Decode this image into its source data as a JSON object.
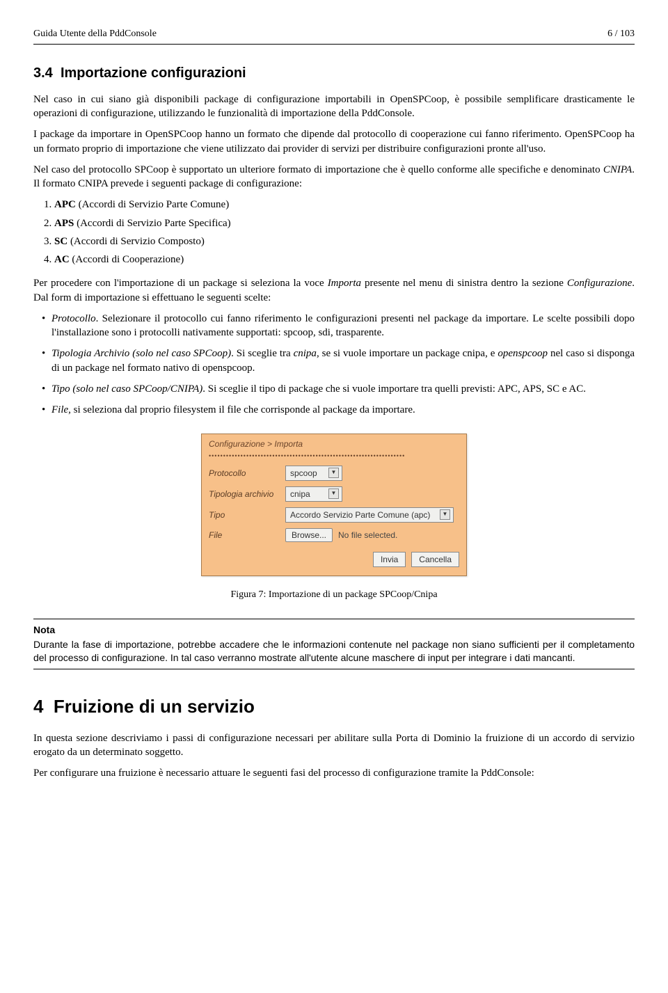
{
  "header": {
    "left": "Guida Utente della PddConsole",
    "right": "6 / 103"
  },
  "sec34": {
    "number": "3.4",
    "title": "Importazione configurazioni",
    "p1": "Nel caso in cui siano già disponibili package di configurazione importabili in OpenSPCoop, è possibile semplificare drasticamente le operazioni di configurazione, utilizzando le funzionalità di importazione della PddConsole.",
    "p2": "I package da importare in OpenSPCoop hanno un formato che dipende dal protocollo di cooperazione cui fanno riferimento. OpenSPCoop ha un formato proprio di importazione che viene utilizzato dai provider di servizi per distribuire configurazioni pronte all'uso.",
    "p3a": "Nel caso del protocollo SPCoop è supportato un ulteriore formato di importazione che è quello conforme alle specifiche e denominato ",
    "p3_em": "CNIPA",
    "p3b": ". Il formato CNIPA prevede i seguenti package di configurazione:",
    "list": [
      {
        "bold": "APC",
        "rest": " (Accordi di Servizio Parte Comune)"
      },
      {
        "bold": "APS",
        "rest": " (Accordi di Servizio Parte Specifica)"
      },
      {
        "bold": "SC",
        "rest": " (Accordi di Servizio Composto)"
      },
      {
        "bold": "AC",
        "rest": " (Accordi di Cooperazione)"
      }
    ],
    "p4a": "Per procedere con l'importazione di un package si seleziona la voce ",
    "p4_em1": "Importa",
    "p4b": " presente nel menu di sinistra dentro la sezione ",
    "p4_em2": "Configurazione",
    "p4c": ". Dal form di importazione si effettuano le seguenti scelte:",
    "bullets": {
      "b1_em": "Protocollo",
      "b1": ". Selezionare il protocollo cui fanno riferimento le configurazioni presenti nel package da importare. Le scelte possibili dopo l'installazione sono i protocolli nativamente supportati: spcoop, sdi, trasparente.",
      "b2_em": "Tipologia Archivio (solo nel caso SPCoop)",
      "b2a": ". Si sceglie tra ",
      "b2_em2": "cnipa",
      "b2b": ", se si vuole importare un package cnipa, e ",
      "b2_em3": "openspcoop",
      "b2c": " nel caso si disponga di un package nel formato nativo di openspcoop.",
      "b3_em": "Tipo (solo nel caso SPCoop/CNIPA)",
      "b3": ". Si sceglie il tipo di package che si vuole importare tra quelli previsti: APC, APS, SC e AC.",
      "b4_em": "File",
      "b4": ", si seleziona dal proprio filesystem il file che corrisponde al package da importare."
    },
    "form": {
      "crumb": "Configurazione > Importa",
      "labels": {
        "protocollo": "Protocollo",
        "tipologia": "Tipologia archivio",
        "tipo": "Tipo",
        "file": "File"
      },
      "values": {
        "protocollo": "spcoop",
        "tipologia": "cnipa",
        "tipo": "Accordo Servizio Parte Comune (apc)"
      },
      "browse": "Browse...",
      "nofile": "No file selected.",
      "submit": "Invia",
      "cancel": "Cancella"
    },
    "figcaption": "Figura 7: Importazione di un package SPCoop/Cnipa",
    "note_title": "Nota",
    "note_body": "Durante la fase di importazione, potrebbe accadere che le informazioni contenute nel package non siano sufficienti per il completamento del processo di configurazione. In tal caso verranno mostrate all'utente alcune maschere di input per integrare i dati mancanti."
  },
  "sec4": {
    "number": "4",
    "title": "Fruizione di un servizio",
    "p1": "In questa sezione descriviamo i passi di configurazione necessari per abilitare sulla Porta di Dominio la fruizione di un accordo di servizio erogato da un determinato soggetto.",
    "p2": "Per configurare una fruizione è necessario attuare le seguenti fasi del processo di configurazione tramite la PddConsole:"
  }
}
